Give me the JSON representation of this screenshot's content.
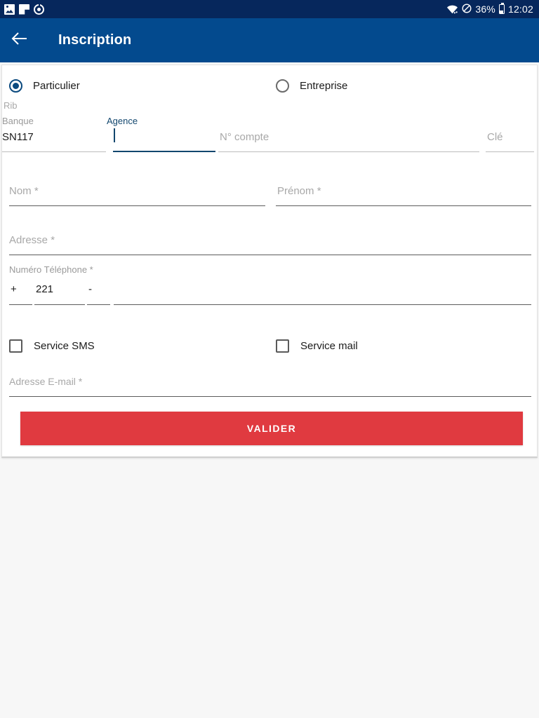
{
  "status_bar": {
    "icons_left": [
      "photo-icon",
      "flag-icon",
      "target-icon"
    ],
    "icons_right": [
      "wifi-icon",
      "do-not-disturb-icon",
      "battery-icon"
    ],
    "battery_percent": "36%",
    "time": "12:02"
  },
  "app_bar": {
    "back_icon": "back-arrow-icon",
    "title": "Inscription"
  },
  "form": {
    "account_type": {
      "options": [
        {
          "label": "Particulier",
          "selected": true
        },
        {
          "label": "Entreprise",
          "selected": false
        }
      ]
    },
    "rib": {
      "section_label": "Rib",
      "banque": {
        "label": "Banque",
        "value": "SN117"
      },
      "agence": {
        "label": "Agence",
        "value": "",
        "focused": true
      },
      "compte": {
        "placeholder": "N° compte",
        "value": ""
      },
      "cle": {
        "placeholder": "Clé",
        "value": ""
      }
    },
    "nom": {
      "placeholder": "Nom *",
      "value": ""
    },
    "prenom": {
      "placeholder": "Prénom *",
      "value": ""
    },
    "adresse": {
      "placeholder": "Adresse *",
      "value": ""
    },
    "telephone": {
      "label": "Numéro Téléphone *",
      "plus": "+",
      "country_code": "221",
      "separator": "-",
      "number": ""
    },
    "services": [
      {
        "label": "Service SMS",
        "checked": false
      },
      {
        "label": "Service mail",
        "checked": false
      }
    ],
    "email": {
      "placeholder": "Adresse E-mail *",
      "value": ""
    },
    "submit_label": "VALIDER"
  },
  "colors": {
    "status_bar": "#06275C",
    "app_bar": "#034A8E",
    "accent": "#12476E",
    "submit": "#E03A40",
    "page_bg": "#F7F7F7"
  }
}
